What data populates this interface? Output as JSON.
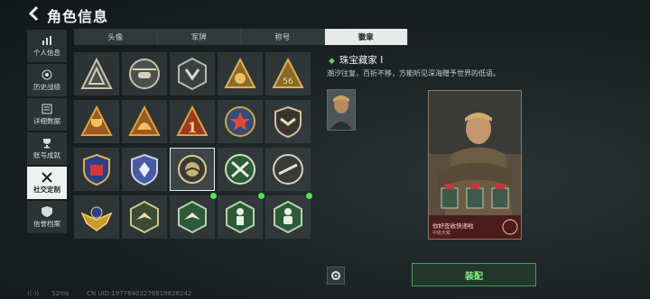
{
  "header": {
    "title": "角色信息"
  },
  "sidebar": {
    "items": [
      {
        "label": "个人信息",
        "icon": "bar-chart-icon"
      },
      {
        "label": "历史战绩",
        "icon": "target-icon"
      },
      {
        "label": "详细数据",
        "icon": "book-icon"
      },
      {
        "label": "账号成就",
        "icon": "trophy-icon"
      },
      {
        "label": "社交定制",
        "icon": "tools-icon",
        "active": true
      },
      {
        "label": "信誉档案",
        "icon": "shield-icon"
      }
    ]
  },
  "tabs": [
    {
      "label": "头像"
    },
    {
      "label": "军牌"
    },
    {
      "label": "称号"
    },
    {
      "label": "徽章",
      "active": true
    }
  ],
  "badges": [
    {
      "icon": "triangle-arrow-badge-icon"
    },
    {
      "icon": "helicopter-badge-icon"
    },
    {
      "icon": "hexagon-emblem-badge-icon"
    },
    {
      "icon": "money-bag-badge-icon"
    },
    {
      "icon": "number-56-badge-icon"
    },
    {
      "icon": "trophy-badge-icon"
    },
    {
      "icon": "helmet-badge-icon"
    },
    {
      "icon": "number-1-badge-icon"
    },
    {
      "icon": "star-medal-badge-icon"
    },
    {
      "icon": "shield-chevron-badge-icon"
    },
    {
      "icon": "blue-shield-badge-icon"
    },
    {
      "icon": "blue-diamond-badge-icon"
    },
    {
      "icon": "gear-globe-badge-icon",
      "selected": true
    },
    {
      "icon": "crossed-rifles-badge-icon"
    },
    {
      "icon": "rifle-badge-icon"
    },
    {
      "icon": "golden-wings-badge-icon"
    },
    {
      "icon": "bird-hexagon-badge-icon"
    },
    {
      "icon": "bird-hexagon-badge-icon",
      "new": true
    },
    {
      "icon": "soldier-hexagon-badge-icon",
      "new": true
    },
    {
      "icon": "thumbs-up-hexagon-badge-icon",
      "new": true
    }
  ],
  "detail": {
    "name": "珠宝藏家 I",
    "description": "潮汐往复，百折不移，方能听见深海赠予世界的低语。",
    "card_text": "你好签收快递啦",
    "card_sub": "中级天赋"
  },
  "actions": {
    "equip": "装配"
  },
  "status": {
    "ping": "52ms",
    "uid": "CN UID:19776403276819826242"
  },
  "colors": {
    "accent": "#4fe35a",
    "active_tab": "#e7eae9"
  }
}
